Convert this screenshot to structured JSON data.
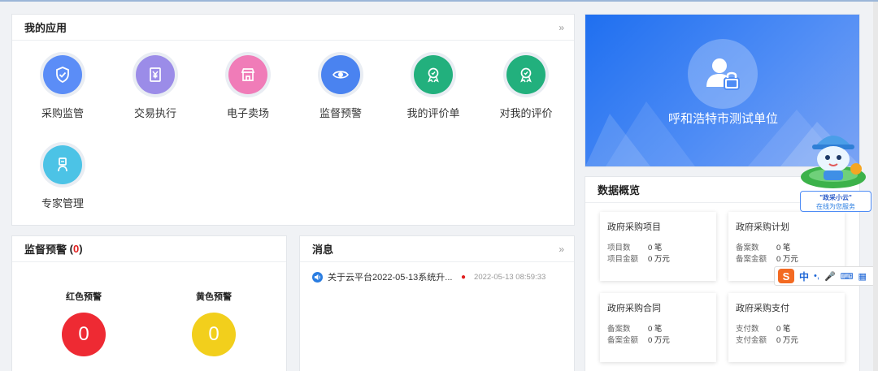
{
  "apps": {
    "title": "我的应用",
    "more": "»",
    "items": [
      {
        "label": "采购监管",
        "icon": "shield-check-icon",
        "color": "#5b8df7"
      },
      {
        "label": "交易执行",
        "icon": "yen-document-icon",
        "color": "#9b8ce8"
      },
      {
        "label": "电子卖场",
        "icon": "storefront-icon",
        "color": "#f07cb8"
      },
      {
        "label": "监督预警",
        "icon": "eye-icon",
        "color": "#4a83f0"
      },
      {
        "label": "我的评价单",
        "icon": "badge-ribbon-icon",
        "color": "#22b07d"
      },
      {
        "label": "对我的评价",
        "icon": "badge-ribbon-icon",
        "color": "#22b07d"
      },
      {
        "label": "专家管理",
        "icon": "expert-person-icon",
        "color": "#4cc3e6"
      }
    ]
  },
  "org": {
    "name": "呼和浩特市测试单位",
    "avatar_icon": "user-lock-icon"
  },
  "overview": {
    "title": "数据概览",
    "cards": [
      {
        "title": "政府采购项目",
        "rows": [
          {
            "k": "项目数",
            "v": "0 笔"
          },
          {
            "k": "项目金额",
            "v": "0 万元"
          }
        ]
      },
      {
        "title": "政府采购计划",
        "rows": [
          {
            "k": "备案数",
            "v": "0 笔"
          },
          {
            "k": "备案金额",
            "v": "0 万元"
          }
        ]
      },
      {
        "title": "政府采购合同",
        "rows": [
          {
            "k": "备案数",
            "v": "0 笔"
          },
          {
            "k": "备案金额",
            "v": "0 万元"
          }
        ]
      },
      {
        "title": "政府采购支付",
        "rows": [
          {
            "k": "支付数",
            "v": "0 笔"
          },
          {
            "k": "支付金额",
            "v": "0 万元"
          }
        ]
      }
    ]
  },
  "warn": {
    "title": "监督预警",
    "count": "0",
    "red_label": "红色预警",
    "red_value": "0",
    "red_color": "#ee2a33",
    "yellow_label": "黄色预警",
    "yellow_value": "0",
    "yellow_color": "#f2cf1c"
  },
  "msg": {
    "title": "消息",
    "more": "»",
    "items": [
      {
        "title": "关于云平台2022-05-13系统升...",
        "time": "2022-05-13 08:59:33",
        "icon": "speaker-icon"
      }
    ]
  },
  "mascot": {
    "line1": "\"政采小云\"",
    "line2": "在线为您服务"
  },
  "ime": {
    "logo": "S",
    "lang": "中"
  }
}
